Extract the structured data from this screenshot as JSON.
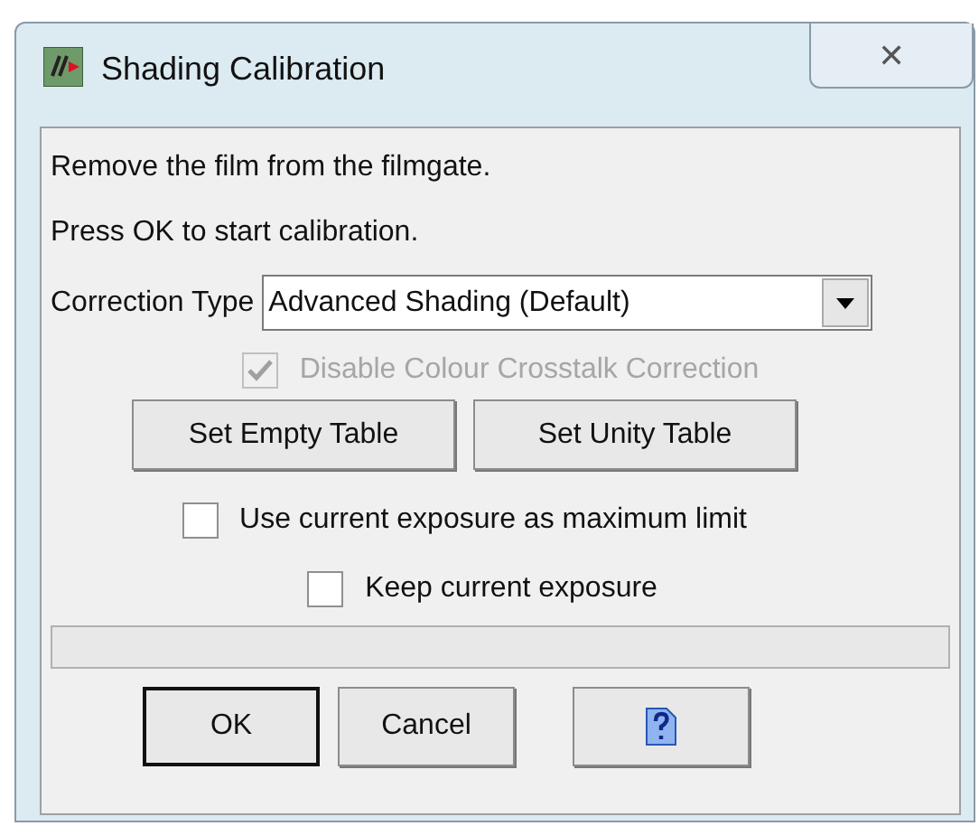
{
  "window": {
    "title": "Shading Calibration",
    "close": "✕"
  },
  "instructions": [
    "Remove the film from the filmgate.",
    "Press OK to start calibration."
  ],
  "correction_type": {
    "label": "Correction Type",
    "value": "Advanced Shading (Default)"
  },
  "checkboxes": [
    {
      "label": "Disable Colour Crosstalk Correction",
      "checked": true,
      "disabled": true
    },
    {
      "label": "Use current exposure as maximum limit",
      "checked": false,
      "disabled": false
    },
    {
      "label": "Keep current exposure",
      "checked": false,
      "disabled": false
    }
  ],
  "table_buttons": [
    "Set Empty Table",
    "Set Unity Table"
  ],
  "buttons": [
    {
      "kind": "default",
      "label": "OK"
    },
    {
      "kind": "normal",
      "label": "Cancel"
    },
    {
      "kind": "help"
    }
  ]
}
